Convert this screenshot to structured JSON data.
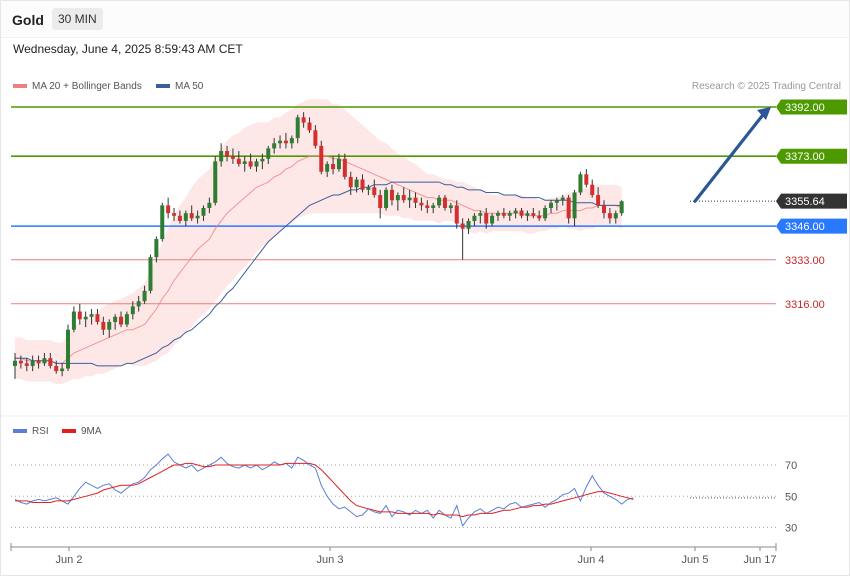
{
  "header": {
    "symbol": "Gold",
    "timeframe": "30 MIN",
    "datetime": "Wednesday, June 4, 2025 8:59:43 AM CET"
  },
  "legend": {
    "main": [
      {
        "label": "MA 20 + Bollinger Bands",
        "color": "#f08080"
      },
      {
        "label": "MA 50",
        "color": "#3a5f9a"
      }
    ],
    "rsi": [
      {
        "label": "RSI",
        "color": "#5b7fd6"
      },
      {
        "label": "9MA",
        "color": "#e02020"
      }
    ],
    "credit": "Research © 2025 Trading Central"
  },
  "colors": {
    "up": "#2e7d32",
    "down": "#d32f2f",
    "resistance": "#4c9a00",
    "pivot": "#2979ff",
    "support": "#e57373",
    "support_text": "#c62828",
    "arrow": "#2b5797",
    "band_fill": "#fde3e3",
    "last": "#333333"
  },
  "chart_data": [
    {
      "type": "candlestick",
      "title": "Gold 30 MIN",
      "ylim": [
        3300,
        3410
      ],
      "x_ticks": [
        "Jun 2",
        "Jun 3",
        "Jun 4",
        "Jun 5",
        "Jun 17"
      ],
      "levels": [
        {
          "label": "3392.00",
          "value": 3392.0,
          "kind": "resistance"
        },
        {
          "label": "3373.00",
          "value": 3373.0,
          "kind": "resistance"
        },
        {
          "label": "3355.64",
          "value": 3355.64,
          "kind": "last"
        },
        {
          "label": "3346.00",
          "value": 3346.0,
          "kind": "pivot"
        },
        {
          "label": "3333.00",
          "value": 3333.0,
          "kind": "support"
        },
        {
          "label": "3316.00",
          "value": 3316.0,
          "kind": "support"
        }
      ],
      "forecast": {
        "from": 3355.6,
        "to": 3392.0
      },
      "candles": [
        [
          3292,
          3297,
          3287,
          3294
        ],
        [
          3294,
          3296,
          3291,
          3293
        ],
        [
          3293,
          3295,
          3290,
          3292
        ],
        [
          3292,
          3296,
          3290,
          3294
        ],
        [
          3294,
          3296,
          3291,
          3293
        ],
        [
          3293,
          3297,
          3292,
          3295
        ],
        [
          3295,
          3297,
          3291,
          3292
        ],
        [
          3292,
          3294,
          3289,
          3290
        ],
        [
          3290,
          3293,
          3288,
          3291
        ],
        [
          3291,
          3308,
          3290,
          3306
        ],
        [
          3306,
          3315,
          3305,
          3313
        ],
        [
          3313,
          3316,
          3308,
          3310
        ],
        [
          3310,
          3313,
          3307,
          3311
        ],
        [
          3311,
          3314,
          3308,
          3312
        ],
        [
          3312,
          3314,
          3308,
          3309
        ],
        [
          3309,
          3311,
          3304,
          3306
        ],
        [
          3306,
          3310,
          3303,
          3309
        ],
        [
          3309,
          3312,
          3306,
          3311
        ],
        [
          3311,
          3313,
          3307,
          3308
        ],
        [
          3308,
          3313,
          3307,
          3312
        ],
        [
          3312,
          3317,
          3310,
          3315
        ],
        [
          3315,
          3319,
          3313,
          3317
        ],
        [
          3317,
          3323,
          3316,
          3321
        ],
        [
          3321,
          3335,
          3320,
          3334
        ],
        [
          3334,
          3342,
          3332,
          3341
        ],
        [
          3341,
          3355,
          3340,
          3354
        ],
        [
          3354,
          3357,
          3349,
          3351
        ],
        [
          3351,
          3353,
          3348,
          3350
        ],
        [
          3350,
          3352,
          3347,
          3348
        ],
        [
          3348,
          3352,
          3346,
          3351
        ],
        [
          3351,
          3354,
          3348,
          3349
        ],
        [
          3349,
          3352,
          3347,
          3350
        ],
        [
          3350,
          3354,
          3348,
          3353
        ],
        [
          3353,
          3357,
          3351,
          3355
        ],
        [
          3355,
          3373,
          3354,
          3371
        ],
        [
          3371,
          3378,
          3369,
          3375
        ],
        [
          3375,
          3377,
          3371,
          3373
        ],
        [
          3373,
          3376,
          3370,
          3372
        ],
        [
          3372,
          3375,
          3369,
          3370
        ],
        [
          3370,
          3373,
          3367,
          3371
        ],
        [
          3371,
          3374,
          3368,
          3369
        ],
        [
          3369,
          3372,
          3367,
          3371
        ],
        [
          3371,
          3374,
          3368,
          3372
        ],
        [
          3372,
          3377,
          3370,
          3376
        ],
        [
          3376,
          3380,
          3374,
          3378
        ],
        [
          3378,
          3381,
          3376,
          3379
        ],
        [
          3379,
          3382,
          3376,
          3378
        ],
        [
          3378,
          3381,
          3376,
          3380
        ],
        [
          3380,
          3389,
          3378,
          3388
        ],
        [
          3388,
          3390,
          3384,
          3386
        ],
        [
          3386,
          3388,
          3382,
          3383
        ],
        [
          3383,
          3385,
          3376,
          3377
        ],
        [
          3377,
          3379,
          3366,
          3367
        ],
        [
          3367,
          3371,
          3365,
          3370
        ],
        [
          3370,
          3373,
          3366,
          3368
        ],
        [
          3368,
          3374,
          3367,
          3372
        ],
        [
          3372,
          3374,
          3364,
          3365
        ],
        [
          3365,
          3367,
          3358,
          3361
        ],
        [
          3361,
          3365,
          3359,
          3364
        ],
        [
          3364,
          3366,
          3359,
          3360
        ],
        [
          3360,
          3362,
          3358,
          3361
        ],
        [
          3361,
          3364,
          3357,
          3358
        ],
        [
          3358,
          3360,
          3349,
          3353
        ],
        [
          3353,
          3361,
          3352,
          3360
        ],
        [
          3360,
          3362,
          3354,
          3356
        ],
        [
          3356,
          3359,
          3352,
          3358
        ],
        [
          3358,
          3361,
          3355,
          3356
        ],
        [
          3356,
          3360,
          3353,
          3357
        ],
        [
          3357,
          3359,
          3353,
          3355
        ],
        [
          3355,
          3357,
          3352,
          3354
        ],
        [
          3354,
          3356,
          3351,
          3353
        ],
        [
          3353,
          3355,
          3351,
          3354
        ],
        [
          3354,
          3358,
          3353,
          3357
        ],
        [
          3357,
          3358,
          3352,
          3353
        ],
        [
          3353,
          3355,
          3351,
          3354
        ],
        [
          3354,
          3356,
          3345,
          3347
        ],
        [
          3347,
          3349,
          3333,
          3345
        ],
        [
          3345,
          3349,
          3343,
          3348
        ],
        [
          3348,
          3351,
          3346,
          3350
        ],
        [
          3350,
          3352,
          3347,
          3351
        ],
        [
          3351,
          3353,
          3345,
          3347
        ],
        [
          3347,
          3351,
          3346,
          3350
        ],
        [
          3350,
          3352,
          3348,
          3351
        ],
        [
          3351,
          3353,
          3349,
          3350
        ],
        [
          3350,
          3352,
          3348,
          3351
        ],
        [
          3351,
          3353,
          3349,
          3352
        ],
        [
          3352,
          3353,
          3349,
          3350
        ],
        [
          3350,
          3352,
          3348,
          3351
        ],
        [
          3351,
          3353,
          3349,
          3350
        ],
        [
          3350,
          3352,
          3348,
          3349
        ],
        [
          3349,
          3354,
          3348,
          3353
        ],
        [
          3353,
          3356,
          3351,
          3355
        ],
        [
          3355,
          3357,
          3352,
          3356
        ],
        [
          3356,
          3358,
          3354,
          3357
        ],
        [
          3357,
          3358,
          3347,
          3349
        ],
        [
          3349,
          3360,
          3346,
          3359
        ],
        [
          3359,
          3367,
          3358,
          3366
        ],
        [
          3366,
          3368,
          3361,
          3362
        ],
        [
          3362,
          3364,
          3357,
          3358
        ],
        [
          3358,
          3361,
          3353,
          3354
        ],
        [
          3354,
          3356,
          3349,
          3351
        ],
        [
          3351,
          3353,
          3347,
          3349
        ],
        [
          3349,
          3352,
          3347,
          3351
        ],
        [
          3351,
          3356,
          3350,
          3355.6
        ]
      ],
      "ma20": [
        3295,
        3295,
        3294,
        3294,
        3294,
        3294,
        3294,
        3293,
        3293,
        3295,
        3297,
        3298,
        3299,
        3300,
        3301,
        3302,
        3303,
        3304,
        3305,
        3306,
        3306,
        3307,
        3308,
        3311,
        3314,
        3318,
        3321,
        3325,
        3328,
        3331,
        3334,
        3337,
        3339,
        3341,
        3345,
        3348,
        3351,
        3353,
        3355,
        3357,
        3359,
        3361,
        3362,
        3363,
        3365,
        3366,
        3368,
        3369,
        3371,
        3372,
        3373,
        3373,
        3373,
        3373,
        3372,
        3372,
        3371,
        3370,
        3369,
        3368,
        3367,
        3366,
        3365,
        3364,
        3363,
        3362,
        3361,
        3360,
        3359,
        3358,
        3357,
        3357,
        3356,
        3356,
        3356,
        3355,
        3354,
        3353,
        3352,
        3352,
        3351,
        3351,
        3351,
        3351,
        3351,
        3351,
        3351,
        3350,
        3350,
        3350,
        3350,
        3351,
        3351,
        3352,
        3352,
        3352,
        3352,
        3353,
        3353,
        3354,
        3354,
        3354,
        3354,
        3353
      ],
      "ma50": [
        3295,
        3295,
        3295,
        3294,
        3294,
        3294,
        3294,
        3293,
        3293,
        3293,
        3293,
        3293,
        3293,
        3293,
        3292,
        3292,
        3292,
        3292,
        3292,
        3293,
        3293,
        3294,
        3295,
        3296,
        3297,
        3299,
        3300,
        3302,
        3303,
        3305,
        3306,
        3308,
        3310,
        3312,
        3315,
        3317,
        3320,
        3322,
        3325,
        3328,
        3331,
        3334,
        3337,
        3340,
        3342,
        3344,
        3346,
        3348,
        3350,
        3352,
        3354,
        3355,
        3356,
        3357,
        3358,
        3358,
        3359,
        3360,
        3360,
        3361,
        3361,
        3362,
        3362,
        3362,
        3363,
        3363,
        3363,
        3363,
        3363,
        3363,
        3363,
        3363,
        3363,
        3362,
        3362,
        3361,
        3361,
        3360,
        3360,
        3360,
        3359,
        3359,
        3359,
        3358,
        3358,
        3358,
        3357,
        3357,
        3357,
        3357,
        3356,
        3356,
        3356,
        3356,
        3356,
        3355,
        3355,
        3355,
        3355,
        3354,
        3354,
        3354,
        3354,
        3354
      ],
      "band_width": [
        8,
        8,
        8,
        8,
        8,
        8,
        8,
        8,
        8,
        9,
        10,
        11,
        11,
        12,
        12,
        13,
        13,
        13,
        13,
        13,
        14,
        15,
        16,
        18,
        20,
        22,
        24,
        25,
        26,
        26,
        27,
        27,
        27,
        27,
        28,
        28,
        28,
        28,
        27,
        27,
        26,
        25,
        24,
        23,
        23,
        22,
        22,
        22,
        22,
        22,
        22,
        22,
        22,
        22,
        21,
        21,
        20,
        19,
        18,
        17,
        16,
        15,
        14,
        14,
        13,
        12,
        12,
        11,
        11,
        10,
        9,
        9,
        9,
        8,
        8,
        8,
        9,
        9,
        9,
        8,
        8,
        7,
        7,
        7,
        7,
        7,
        7,
        7,
        7,
        6,
        6,
        6,
        6,
        6,
        7,
        7,
        8,
        8,
        8,
        8,
        8,
        8,
        8,
        8
      ]
    },
    {
      "type": "line",
      "title": "RSI",
      "ylim": [
        20,
        80
      ],
      "y_ticks": [
        70,
        50,
        30
      ],
      "series": [
        {
          "name": "RSI",
          "values": [
            48,
            46,
            45,
            47,
            48,
            47,
            48,
            49,
            47,
            45,
            50,
            55,
            59,
            57,
            55,
            57,
            58,
            54,
            52,
            55,
            58,
            59,
            62,
            67,
            70,
            74,
            77,
            72,
            70,
            68,
            70,
            66,
            68,
            70,
            72,
            75,
            71,
            69,
            68,
            70,
            68,
            70,
            67,
            69,
            72,
            70,
            71,
            68,
            75,
            73,
            70,
            68,
            57,
            50,
            45,
            42,
            43,
            40,
            37,
            38,
            42,
            40,
            39,
            44,
            37,
            41,
            40,
            38,
            41,
            39,
            41,
            36,
            41,
            38,
            36,
            44,
            31,
            36,
            40,
            42,
            39,
            41,
            43,
            42,
            45,
            46,
            43,
            44,
            45,
            46,
            43,
            46,
            48,
            51,
            52,
            55,
            47,
            56,
            63,
            57,
            52,
            50,
            48,
            45,
            48,
            49
          ]
        },
        {
          "name": "9MA",
          "values": [
            47,
            47,
            47,
            46,
            46,
            46,
            46,
            47,
            47,
            47,
            48,
            49,
            50,
            51,
            52,
            54,
            55,
            56,
            57,
            57,
            57,
            58,
            60,
            62,
            64,
            66,
            68,
            70,
            70,
            71,
            71,
            70,
            69,
            69,
            70,
            70,
            70,
            70,
            70,
            70,
            70,
            70,
            70,
            70,
            70,
            70,
            71,
            71,
            71,
            71,
            71,
            70,
            67,
            63,
            59,
            55,
            51,
            47,
            44,
            43,
            42,
            41,
            40,
            40,
            40,
            39,
            39,
            39,
            39,
            39,
            39,
            38,
            39,
            38,
            38,
            38,
            37,
            38,
            38,
            39,
            39,
            39,
            40,
            41,
            41,
            42,
            43,
            43,
            44,
            44,
            45,
            45,
            46,
            47,
            48,
            49,
            50,
            51,
            52,
            53,
            53,
            52,
            51,
            50,
            49,
            48
          ]
        }
      ],
      "last_value_line": 49
    }
  ]
}
